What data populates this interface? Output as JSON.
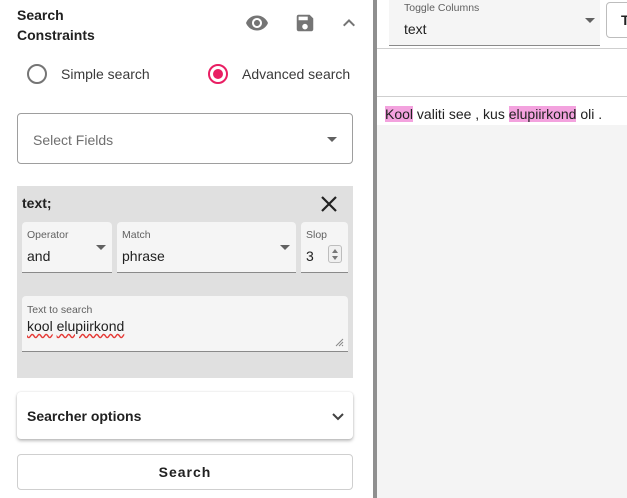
{
  "search_panel": {
    "title_line1": "Search",
    "title_line2": "Constraints",
    "mode_simple": "Simple search",
    "mode_advanced": "Advanced search",
    "selected_mode": "advanced",
    "select_fields_placeholder": "Select Fields",
    "constraint": {
      "field": "text;",
      "operator_label": "Operator",
      "operator_value": "and",
      "match_label": "Match",
      "match_value": "phrase",
      "slop_label": "Slop",
      "slop_value": "3",
      "text_label": "Text to search",
      "text_word1": "kool",
      "text_word2": "elupiirkond"
    },
    "searcher_options_label": "Searcher options",
    "search_button": "Search"
  },
  "results_panel": {
    "toggle_columns_label": "Toggle Columns",
    "toggle_columns_value": "text",
    "partial_button_label": "T",
    "result": {
      "hl1": "Kool",
      "mid": " valiti see , kus ",
      "hl2": "elupiirkond",
      "end": " oli ."
    }
  },
  "colors": {
    "accent": "#e91e63",
    "highlight": "#f3a2de",
    "divider": "#8f8f8f",
    "constraint_bg": "#e0e0e0"
  },
  "icons": {
    "header": [
      "eye-icon",
      "save-icon",
      "chevron-up-icon"
    ],
    "constraint": [
      "close-icon"
    ],
    "searcher": [
      "chevron-down-icon"
    ]
  }
}
